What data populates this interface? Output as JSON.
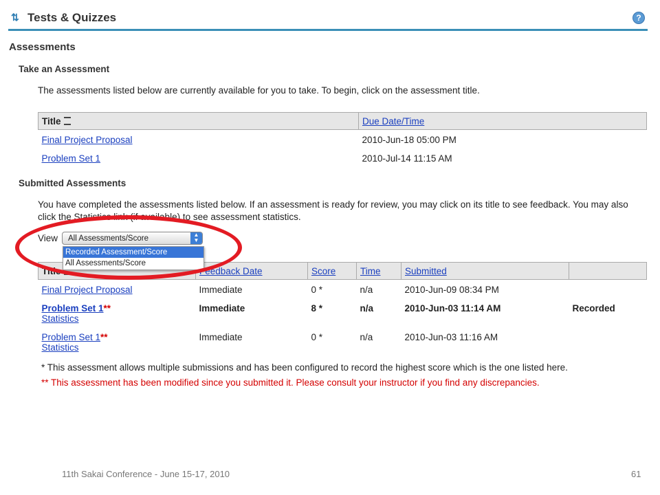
{
  "tool": {
    "title": "Tests & Quizzes",
    "icon": "refresh-arrows-icon",
    "help_icon": "help-icon",
    "help_glyph": "?"
  },
  "page_title": "Assessments",
  "take": {
    "heading": "Take an Assessment",
    "intro": "The assessments listed below are currently available for you to take. To begin, click on the assessment title.",
    "columns": [
      "Title",
      "Due Date/Time"
    ],
    "rows": [
      {
        "title": "Final Project Proposal",
        "due": "2010-Jun-18 05:00 PM"
      },
      {
        "title": "Problem Set 1",
        "due": "2010-Jul-14 11:15 AM"
      }
    ]
  },
  "submitted": {
    "heading": "Submitted Assessments",
    "intro": "You have completed the assessments listed below. If an assessment is ready for review, you may click on its title to see feedback. You may also click the Statistics link (if available) to see assessment statistics.",
    "view_label": "View",
    "view_selected": "All Assessments/Score",
    "view_options": [
      "Recorded Assessment/Score",
      "All Assessments/Score"
    ],
    "columns": [
      "Title",
      "Feedback Date",
      "Score",
      "Time",
      "Submitted",
      ""
    ],
    "rows": [
      {
        "title": "Final Project Proposal",
        "mark": "",
        "stats": "",
        "feedback": "Immediate",
        "score": "0 *",
        "time": "n/a",
        "submitted": "2010-Jun-09 08:34 PM",
        "status": ""
      },
      {
        "title": "Problem Set 1",
        "mark": "**",
        "stats": "Statistics",
        "feedback": "Immediate",
        "score": "8 *",
        "time": "n/a",
        "submitted": "2010-Jun-03 11:14 AM",
        "status": "Recorded"
      },
      {
        "title": "Problem Set 1",
        "mark": "**",
        "stats": "Statistics",
        "feedback": "Immediate",
        "score": "0 *",
        "time": "n/a",
        "submitted": "2010-Jun-03 11:16 AM",
        "status": ""
      }
    ],
    "note1": "* This assessment allows multiple submissions and has been configured to record the highest score which is the one listed here.",
    "note2": "** This assessment has been modified since you submitted it. Please consult your instructor if you find any discrepancies."
  },
  "footer": {
    "left": "11th Sakai Conference - June 15-17, 2010",
    "right": "61"
  },
  "colors": {
    "accent": "#3a8fb7",
    "link": "#1a3fbf",
    "warning": "#d40000",
    "highlight": "#e31b23"
  }
}
